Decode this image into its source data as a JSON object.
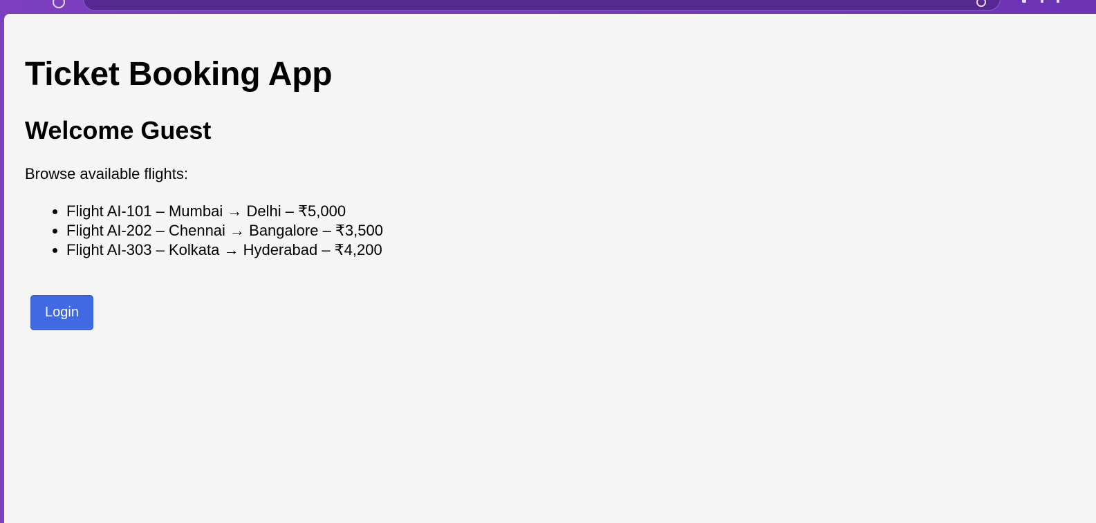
{
  "page": {
    "title": "Ticket Booking App",
    "welcome": "Welcome Guest",
    "intro": "Browse available flights:",
    "flights": [
      "Flight AI-101 – Mumbai → Delhi – ₹5,000",
      "Flight AI-202 – Chennai → Bangalore – ₹3,500",
      "Flight AI-303 – Kolkata → Hyderabad – ₹4,200"
    ],
    "login_label": "Login"
  },
  "colors": {
    "browser_frame": "#6c34b4",
    "page_background": "#f5f5f5",
    "login_button": "#4169e1"
  }
}
